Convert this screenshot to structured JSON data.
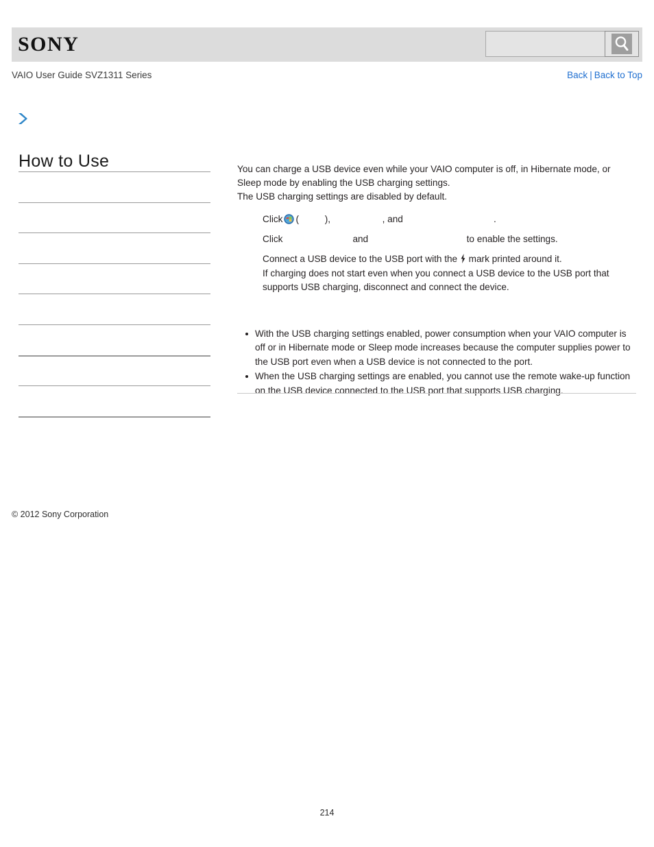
{
  "header": {
    "logo_text": "SONY",
    "search_value": "",
    "search_placeholder": "",
    "search_icon": "magnifying-glass-icon"
  },
  "sub_header": {
    "guide_title": "VAIO User Guide SVZ1311 Series",
    "back_label": "Back",
    "separator": "|",
    "back_to_top_label": "Back to Top"
  },
  "sidebar": {
    "chevron_icon": "chevron-right-icon",
    "title": "How to Use",
    "items": [
      {
        "label": ""
      },
      {
        "label": ""
      },
      {
        "label": ""
      },
      {
        "label": ""
      },
      {
        "label": ""
      },
      {
        "label": ""
      },
      {
        "label": ""
      },
      {
        "label": ""
      },
      {
        "label": ""
      },
      {
        "label": ""
      }
    ],
    "copyright": "© 2012 Sony Corporation"
  },
  "content": {
    "intro": [
      "You can charge a USB device even while your VAIO computer is off, in Hibernate mode, or",
      "Sleep mode by enabling the USB charging settings.",
      "The USB charging settings are disabled by default."
    ],
    "steps": [
      {
        "prefix": "Click",
        "icon": "windows-start-orb-icon",
        "open_paren": "(",
        "hidden_1": "          ",
        "close_paren": "),",
        "hidden_2": "                    ",
        "mid": ", and",
        "hidden_3": "                                   ",
        "suffix": "."
      },
      {
        "prefix": "Click",
        "hidden_1": "                           ",
        "mid": "and",
        "hidden_2": "                                      ",
        "suffix": "to enable the settings."
      },
      {
        "before_bolt": "Connect a USB device to the USB port with the",
        "bolt_icon": "lightning-bolt-icon",
        "after_bolt": "mark printed around it."
      },
      {
        "line_1": "If charging does not start even when you connect a USB device to the USB port that",
        "line_2": "supports USB charging, disconnect and connect the device."
      }
    ],
    "notes": [
      "With the USB charging settings enabled, power consumption when your VAIO computer is off or in Hibernate mode or Sleep mode increases because the computer supplies power to the USB port even when a USB device is not connected to the port.",
      "When the USB charging settings are enabled, you cannot use the remote wake-up function on the USB device connected to the USB port that supports USB charging."
    ]
  },
  "footer": {
    "page_number": "214"
  }
}
